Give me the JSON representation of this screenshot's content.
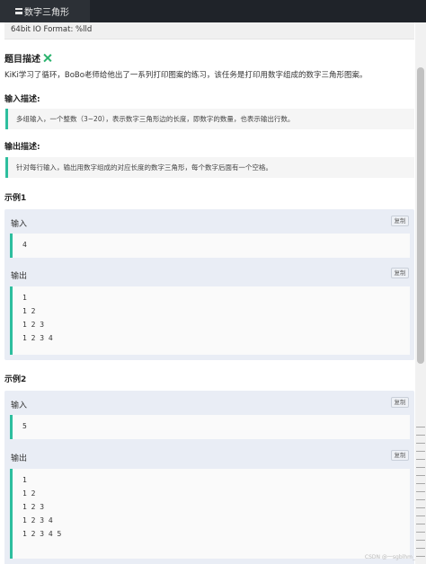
{
  "tab": {
    "title": "数字三角形",
    "icon": "menu-icon"
  },
  "io_format": "64bit IO Format: %lld",
  "problem": {
    "title": "题目描述",
    "expand_icon": "expand-icon",
    "description": "KiKi学习了循环，BoBo老师给他出了一系列打印图案的练习，该任务是打印用数字组成的数字三角形图案。"
  },
  "input_desc": {
    "heading": "输入描述:",
    "text": "多组输入，一个整数（3~20），表示数字三角形边的长度，即数字的数量，也表示输出行数。"
  },
  "output_desc": {
    "heading": "输出描述:",
    "text": "针对每行输入，输出用数字组成的对应长度的数字三角形，每个数字后面有一个空格。"
  },
  "examples": [
    {
      "title": "示例1",
      "input_label": "输入",
      "output_label": "输出",
      "copy_label": "复制",
      "input_lines": [
        "4"
      ],
      "output_lines": [
        "1",
        "1 2",
        "1 2 3",
        "1 2 3 4"
      ]
    },
    {
      "title": "示例2",
      "input_label": "输入",
      "output_label": "输出",
      "copy_label": "复制",
      "input_lines": [
        "5"
      ],
      "output_lines": [
        "1",
        "1 2",
        "1 2 3",
        "1 2 3 4",
        "1 2 3 4 5"
      ]
    }
  ],
  "watermark": "CSDN @一sgblhm_"
}
